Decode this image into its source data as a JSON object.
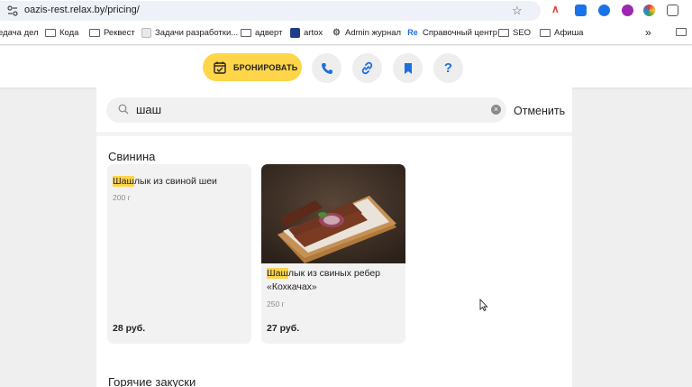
{
  "browser": {
    "url": "oazis-rest.relax.by/pricing/",
    "bookmarks": [
      {
        "label": "едача дел",
        "icon": "folder-icon"
      },
      {
        "label": "Кода",
        "icon": "folder-icon"
      },
      {
        "label": "Реквест",
        "icon": "folder-icon"
      },
      {
        "label": "Задачи разработки...",
        "icon": "doc-icon"
      },
      {
        "label": "адверт",
        "icon": "folder-icon"
      },
      {
        "label": "artox",
        "icon": "artox-icon"
      },
      {
        "label": "Admin журнал",
        "icon": "gear-icon"
      },
      {
        "label": "Справочный центр",
        "icon": "re-icon"
      },
      {
        "label": "SEO",
        "icon": "folder-icon"
      },
      {
        "label": "Афиша",
        "icon": "folder-icon"
      }
    ],
    "more_bookmarks": "»"
  },
  "header": {
    "book_label": "БРОНИРОВАТЬ",
    "buttons": [
      {
        "icon": "phone-icon"
      },
      {
        "icon": "link-icon"
      },
      {
        "icon": "bookmark-icon"
      },
      {
        "icon": "help-icon",
        "glyph": "?"
      }
    ],
    "accent_color": "#ffd54a",
    "icon_color": "#1e6fd9"
  },
  "search": {
    "value": "шаш",
    "cancel_label": "Отменить"
  },
  "sections": [
    {
      "title": "Свинина",
      "items": [
        {
          "title_highlight": "Шаш",
          "title_rest": "лык из свиной шеи",
          "weight": "200 г",
          "price": "28 руб.",
          "has_photo": false
        },
        {
          "title_highlight": "Шаш",
          "title_rest": "лык из свиных ребер «Кохкачах»",
          "weight": "250 г",
          "price": "27 руб.",
          "has_photo": true
        }
      ]
    },
    {
      "title": "Горячие закуски"
    }
  ]
}
